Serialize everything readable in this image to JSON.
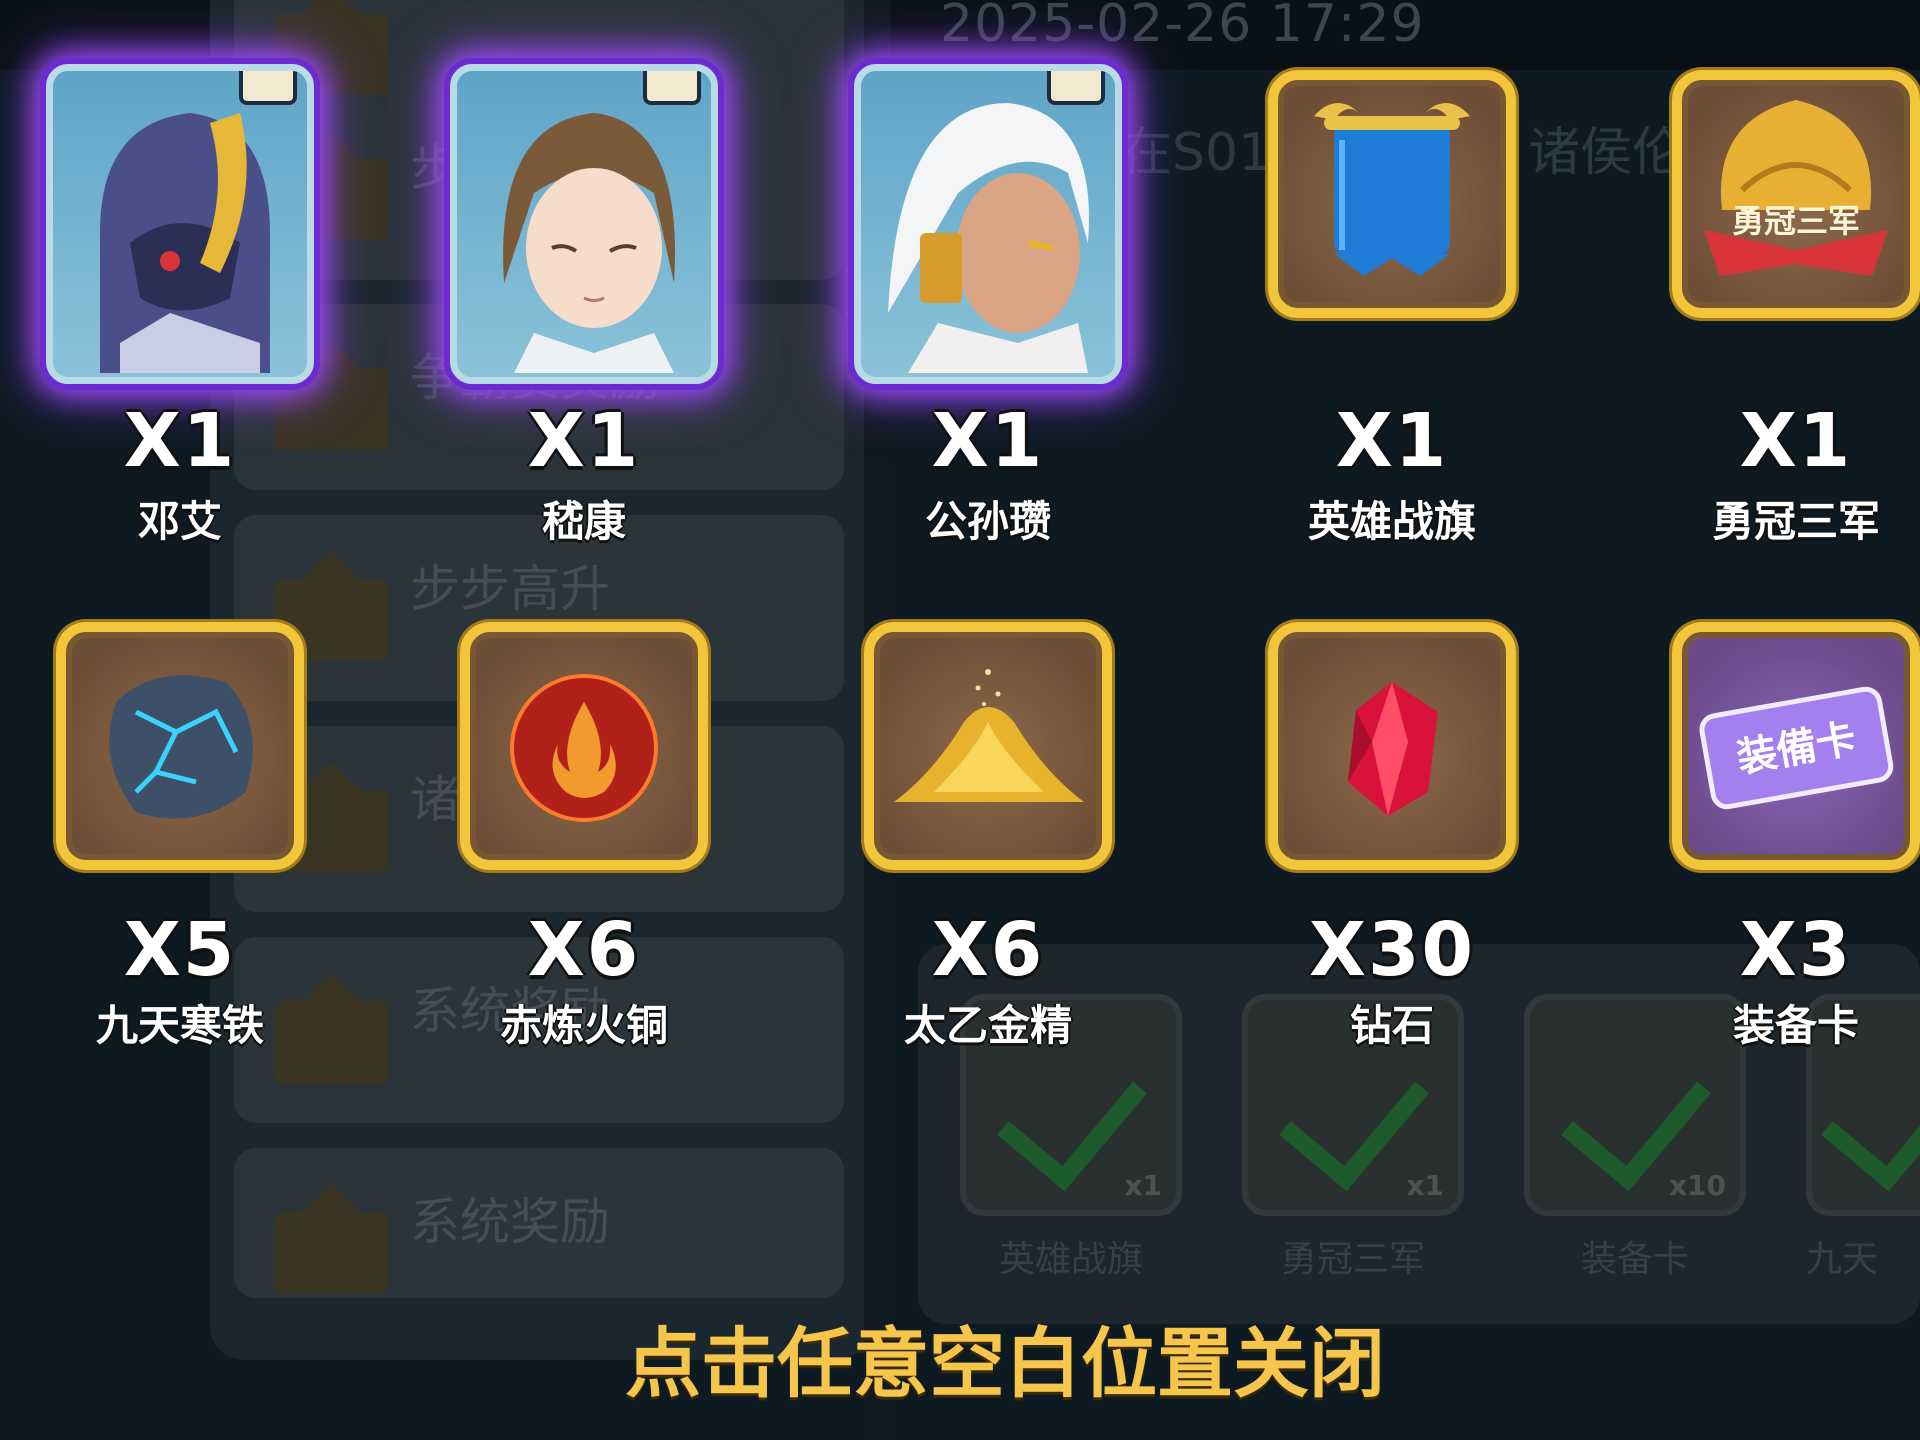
{
  "background": {
    "timestamp": "2025-02-26 17:29",
    "mail_items": [
      {
        "title": "步"
      },
      {
        "title": "争霸赛奖励"
      },
      {
        "title": "步步高升"
      },
      {
        "title": "诸..."
      },
      {
        "title": "系统奖励"
      },
      {
        "title": "系统奖励"
      }
    ],
    "detail_title_left": "在S01",
    "detail_title_right": "诸侯伦",
    "received_items": [
      {
        "label": "英雄战旗",
        "count": "x1"
      },
      {
        "label": "勇冠三军",
        "count": "x1"
      },
      {
        "label": "装备卡",
        "count": "x10"
      },
      {
        "label": "九天",
        "count": ""
      }
    ]
  },
  "rewards": [
    {
      "name": "邓艾",
      "quantity": "X1",
      "kind": "hero",
      "icon": "hero-dengai-portrait"
    },
    {
      "name": "嵇康",
      "quantity": "X1",
      "kind": "hero",
      "icon": "hero-jikang-portrait"
    },
    {
      "name": "公孙瓒",
      "quantity": "X1",
      "kind": "hero",
      "icon": "hero-gongsunzan-portrait"
    },
    {
      "name": "英雄战旗",
      "quantity": "X1",
      "kind": "item",
      "icon": "hero-banner-icon"
    },
    {
      "name": "勇冠三军",
      "quantity": "X1",
      "kind": "item",
      "icon": "valor-medal-icon"
    },
    {
      "name": "九天寒铁",
      "quantity": "X5",
      "kind": "item",
      "icon": "cold-iron-ore-icon"
    },
    {
      "name": "赤炼火铜",
      "quantity": "X6",
      "kind": "item",
      "icon": "fire-copper-orb-icon"
    },
    {
      "name": "太乙金精",
      "quantity": "X6",
      "kind": "item",
      "icon": "gold-dust-pile-icon"
    },
    {
      "name": "钻石",
      "quantity": "X30",
      "kind": "item",
      "icon": "red-diamond-icon"
    },
    {
      "name": "装备卡",
      "quantity": "X3",
      "kind": "item",
      "icon": "equipment-card-icon"
    }
  ],
  "equipment_card_text": "装備卡",
  "valor_badge_text": "勇冠三军",
  "close_hint": "点击任意空白位置关闭",
  "colors": {
    "hero_glow": "#a14cff",
    "item_frame": "#f2c63a",
    "hint_text": "#f5c64b"
  }
}
